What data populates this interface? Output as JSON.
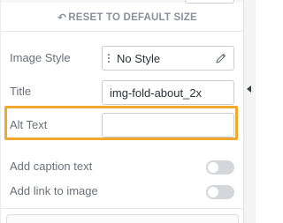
{
  "reset": {
    "label": "RESET TO DEFAULT SIZE",
    "icon": "undo-icon"
  },
  "image_style": {
    "label": "Image Style",
    "value": "No Style",
    "icon": "pencil-icon"
  },
  "title": {
    "label": "Title",
    "value": "img-fold-about_2x"
  },
  "alt_text": {
    "label": "Alt Text",
    "value": ""
  },
  "caption": {
    "label": "Add caption text",
    "enabled": false
  },
  "link": {
    "label": "Add link to image",
    "enabled": false
  },
  "colors": {
    "highlight": "#f2a82e",
    "toggle_off": "#d4d6da"
  },
  "collapse_icon": "caret-left-icon"
}
